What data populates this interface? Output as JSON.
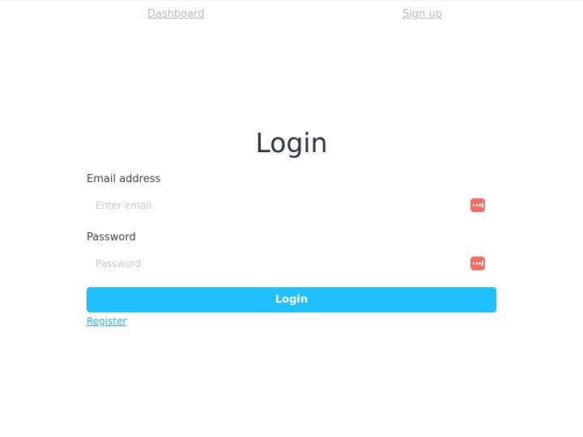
{
  "nav": {
    "dashboard": "Dashboard",
    "signup": "Sign up"
  },
  "form": {
    "title": "Login",
    "email": {
      "label": "Email address",
      "placeholder": "Enter email",
      "value": ""
    },
    "password": {
      "label": "Password",
      "placeholder": "Password",
      "value": ""
    },
    "submit_label": "Login",
    "register_label": "Register"
  },
  "icons": {
    "field_icon": "password-manager-icon"
  },
  "colors": {
    "accent": "#1fc2ff",
    "icon": "#f76b64",
    "title": "#2b3340",
    "nav_link": "#bbbbbb",
    "register_link": "#2ab1e0"
  }
}
